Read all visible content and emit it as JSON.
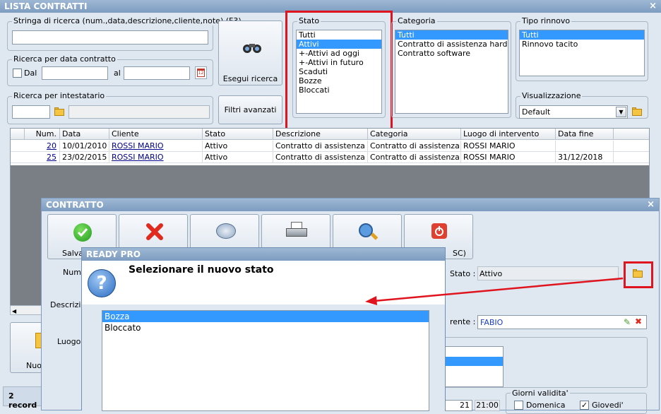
{
  "main_window": {
    "title": "LISTA CONTRATTI",
    "close": "×"
  },
  "search": {
    "label": "Stringa di ricerca (num.,data,descrizione,cliente,note) (F3)",
    "value": "",
    "button": "Esegui ricerca",
    "advanced_button": "Filtri avanzati"
  },
  "date_search": {
    "label": "Ricerca per data contratto",
    "dal": "Dal",
    "al": "al"
  },
  "owner_search": {
    "label": "Ricerca per intestatario"
  },
  "stato": {
    "label": "Stato",
    "items": [
      "Tutti",
      "Attivi",
      "+-Attivi ad oggi",
      "+-Attivi in futuro",
      "Scaduti",
      "Bozze",
      "Bloccati"
    ],
    "selected_index": 1
  },
  "categoria": {
    "label": "Categoria",
    "items": [
      "Tutti",
      "Contratto di assistenza hardware",
      "Contratto software"
    ],
    "selected_index": 0
  },
  "tipo_rinnovo": {
    "label": "Tipo rinnovo",
    "items": [
      "Tutti",
      "Rinnovo tacito"
    ],
    "selected_index": 0
  },
  "visualizzazione": {
    "label": "Visualizzazione",
    "value": "Default"
  },
  "grid": {
    "columns": [
      "Num.",
      "Data",
      "Cliente",
      "Stato",
      "Descrizione",
      "Categoria",
      "Luogo di intervento",
      "Data fine"
    ],
    "rows": [
      {
        "num": "20",
        "data": "10/01/2010",
        "cliente": "ROSSI MARIO",
        "stato": "Attivo",
        "descrizione": "Contratto di assistenza ...",
        "categoria": "Contratto di assistenza ...",
        "luogo": "ROSSI MARIO",
        "data_fine": ""
      },
      {
        "num": "25",
        "data": "23/02/2015",
        "cliente": "ROSSI MARIO",
        "stato": "Attivo",
        "descrizione": "Contratto di assistenza ...",
        "categoria": "Contratto di assistenza ...",
        "luogo": "ROSSI MARIO",
        "data_fine": "31/12/2018"
      }
    ]
  },
  "left_panel": {
    "nuovo_label": "Nuov",
    "records": "2 record"
  },
  "contratto": {
    "title": "CONTRATTO",
    "close": "×",
    "salva": "Salva",
    "esc_label": "SC)",
    "numero_label": "Nume",
    "descrizione_label": "Descrizi",
    "luogo_label": "Luogo",
    "stato_label": "Stato :",
    "stato_value": "Attivo",
    "referente_label": "rente :",
    "referente_value": "FABIO",
    "giorni_label": "Giorni validita'",
    "domenica": "Domenica",
    "giovedi": "Giovedi'",
    "day_value": "21",
    "time_value": "21:00"
  },
  "dialog": {
    "title": "READY PRO",
    "message": "Selezionare il nuovo stato",
    "options": [
      "Bozza",
      "Bloccato"
    ],
    "selected_index": 0
  }
}
